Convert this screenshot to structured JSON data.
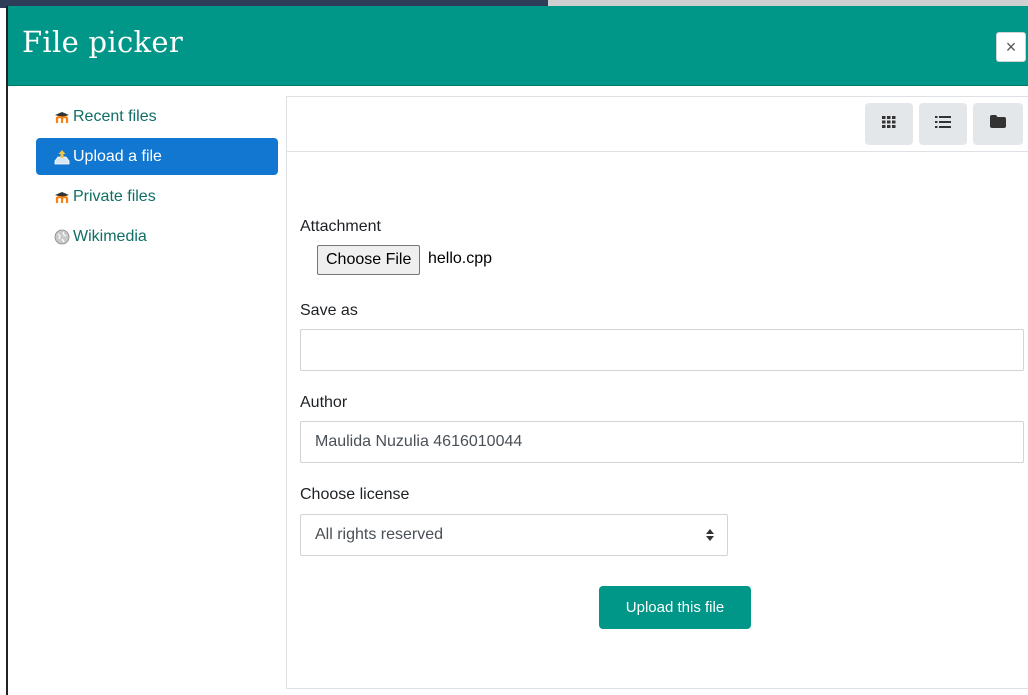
{
  "dialog": {
    "title": "File picker",
    "close_label": "×"
  },
  "sidebar": {
    "items": [
      {
        "label": "Recent files",
        "icon": "moodle-icon",
        "active": false
      },
      {
        "label": "Upload a file",
        "icon": "upload-icon",
        "active": true
      },
      {
        "label": "Private files",
        "icon": "moodle-icon",
        "active": false
      },
      {
        "label": "Wikimedia",
        "icon": "wikimedia-icon",
        "active": false
      }
    ]
  },
  "toolbar": {
    "views": [
      "grid-view-icon",
      "list-view-icon",
      "folder-view-icon"
    ]
  },
  "form": {
    "attachment_label": "Attachment",
    "choose_file_label": "Choose File",
    "chosen_file": "hello.cpp",
    "save_as_label": "Save as",
    "save_as_value": "",
    "author_label": "Author",
    "author_value": "Maulida Nuzulia 4616010044",
    "license_label": "Choose license",
    "license_value": "All rights reserved",
    "upload_label": "Upload this file"
  },
  "colors": {
    "header": "#009688",
    "active_item": "#1177d1",
    "link": "#0f6e64",
    "primary_button": "#009688"
  }
}
